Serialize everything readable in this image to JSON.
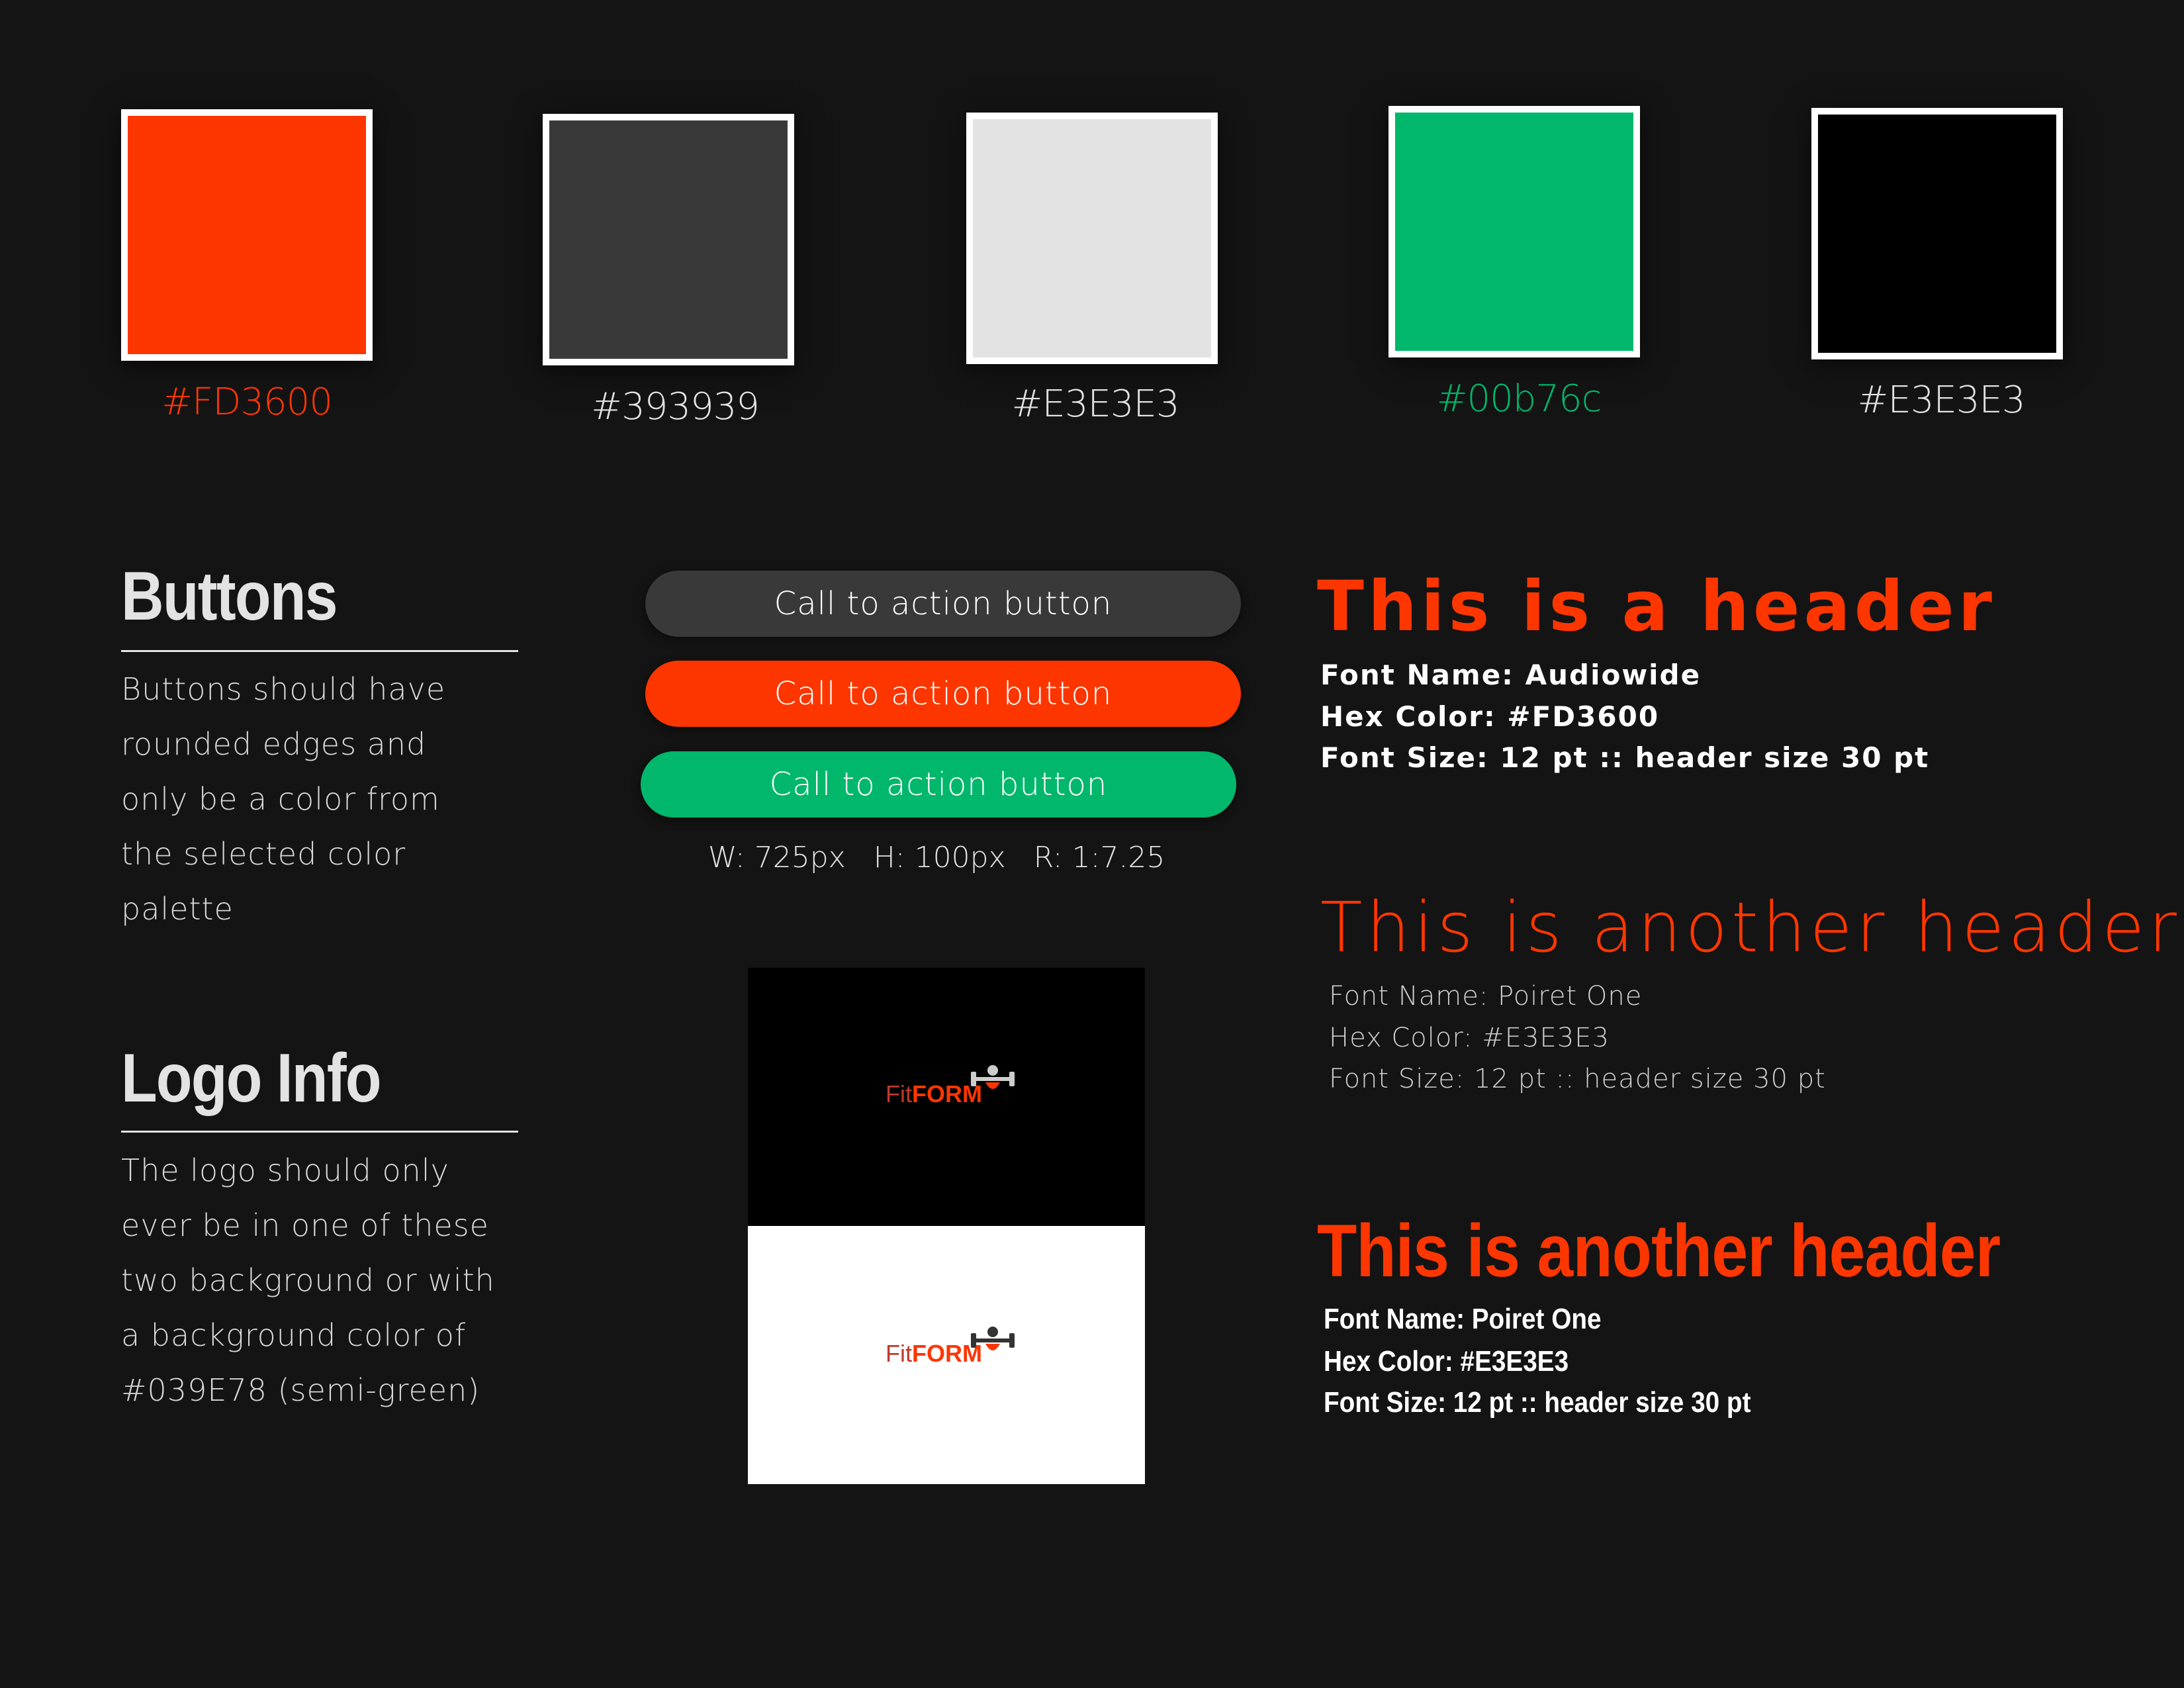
{
  "palette": {
    "swatches": [
      {
        "fill": "#FD3600",
        "label": "#FD3600",
        "label_color": "#FD3600"
      },
      {
        "fill": "#393939",
        "label": "#393939",
        "label_color": "#E3E3E3"
      },
      {
        "fill": "#E3E3E3",
        "label": "#E3E3E3",
        "label_color": "#E3E3E3"
      },
      {
        "fill": "#00B76C",
        "label": "#00b76c",
        "label_color": "#00B76C"
      },
      {
        "fill": "#000000",
        "label": "#E3E3E3",
        "label_color": "#E3E3E3"
      }
    ]
  },
  "buttons_section": {
    "title": "Buttons",
    "lines": [
      "Buttons should have",
      "rounded edges and",
      "only be a color from",
      "the selected color",
      "palette"
    ]
  },
  "logo_section": {
    "title": "Logo Info",
    "lines": [
      "The logo should only",
      "ever be in one of these",
      "two background or with",
      "a background color of",
      "#039E78 (semi-green)"
    ]
  },
  "cta_buttons": [
    {
      "label": "Call to action button",
      "color": "#393939"
    },
    {
      "label": "Call to action button",
      "color": "#FD3600"
    },
    {
      "label": "Call to action button",
      "color": "#00B76C"
    }
  ],
  "button_dims": {
    "width": "W: 725px",
    "height": "H: 100px",
    "ratio": "R: 1:7.25"
  },
  "logo": {
    "fit": "Fit",
    "form": "FORM"
  },
  "header_samples": [
    {
      "title": "This is a header",
      "font_name": "Font Name: Audiowide",
      "hex_color": "Hex Color: #FD3600",
      "font_size": "Font Size: 12 pt :: header size 30 pt"
    },
    {
      "title": "This is another header",
      "font_name": "Font Name: Poiret One",
      "hex_color": "Hex Color: #E3E3E3",
      "font_size": "Font Size: 12 pt :: header size 30 pt"
    },
    {
      "title": "This is another header",
      "font_name": "Font Name: Poiret One",
      "hex_color": "Hex Color: #E3E3E3",
      "font_size": "Font Size: 12 pt :: header size 30 pt"
    }
  ]
}
